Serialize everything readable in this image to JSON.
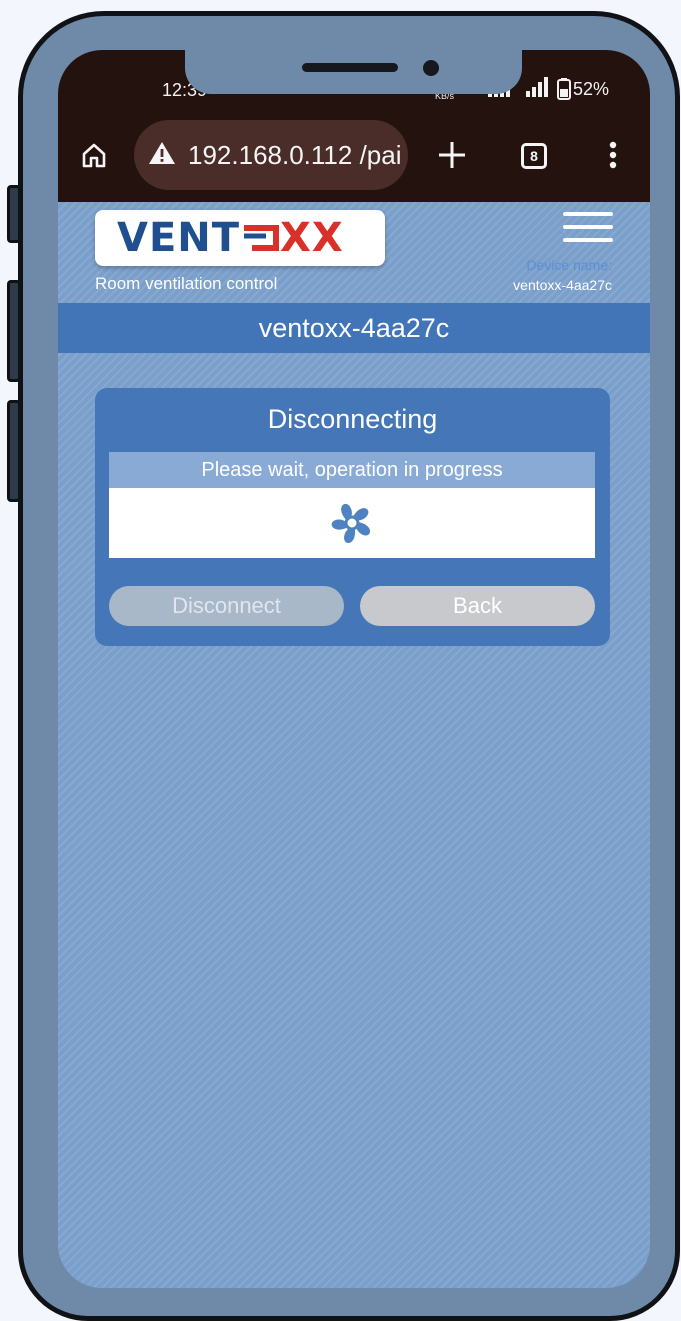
{
  "status_bar": {
    "time": "12:39",
    "network_speed": "KB/s",
    "battery_percent": "52%"
  },
  "browser": {
    "url": "192.168.0.112 /pai",
    "tab_count": "8",
    "icons": [
      "home-icon",
      "warning-icon",
      "plus-icon",
      "tabs-icon",
      "more-vert-icon"
    ]
  },
  "header": {
    "logo_text_a": "VENT",
    "logo_text_b": "XX",
    "subtitle": "Room ventilation control",
    "device_name_label": "Device name:",
    "device_name_value": "ventoxx-4aa27c"
  },
  "device_bar": {
    "title": "ventoxx-4aa27c"
  },
  "dialog": {
    "title": "Disconnecting",
    "message": "Please wait, operation in progress",
    "buttons": {
      "disconnect": "Disconnect",
      "back": "Back"
    }
  },
  "colors": {
    "page_bg": "#7b9fcb",
    "accent_blue": "#4275b8",
    "logo_blue": "#1f4f8e",
    "logo_red": "#d9302a"
  }
}
